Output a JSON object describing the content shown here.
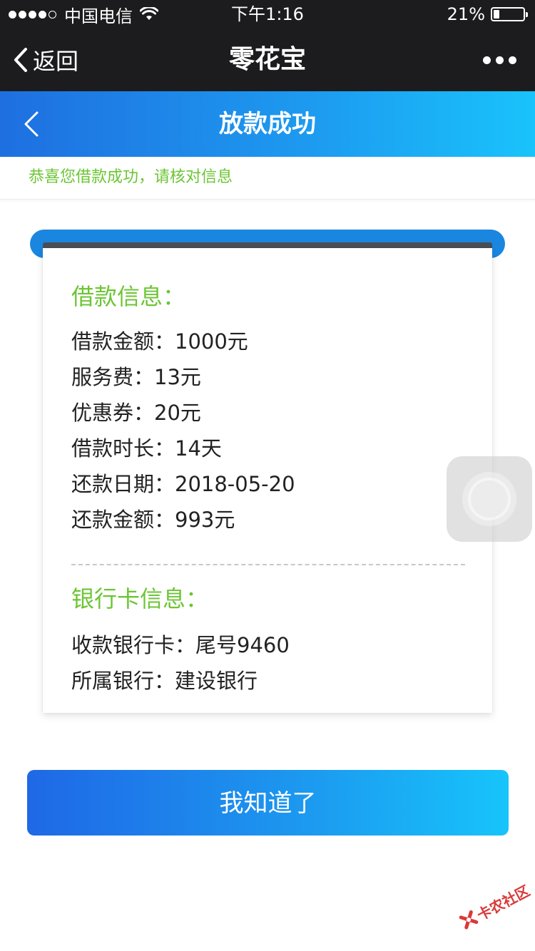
{
  "status_bar": {
    "carrier": "中国电信",
    "time": "下午1:16",
    "battery_percent": "21%",
    "battery_level": 0.21
  },
  "nav": {
    "back_label": "返回",
    "title": "零花宝"
  },
  "header": {
    "title": "放款成功"
  },
  "notice": {
    "text": "恭喜您借款成功，请核对信息"
  },
  "loan_info": {
    "title": "借款信息：",
    "rows": [
      "借款金额：1000元",
      "服务费：13元",
      "优惠券：20元",
      "借款时长：14天",
      "还款日期：2018-05-20",
      "还款金额：993元"
    ]
  },
  "bank_info": {
    "title": "银行卡信息：",
    "rows": [
      "收款银行卡：尾号9460",
      "所属银行：建设银行"
    ]
  },
  "confirm_button": {
    "label": "我知道了"
  },
  "watermark": {
    "text": "卡农社区"
  },
  "colors": {
    "accent_green": "#6cc534",
    "header_blue_start": "#1e6fe0",
    "header_blue_end": "#19c3fb",
    "dark_bar": "#1c1c1e"
  }
}
